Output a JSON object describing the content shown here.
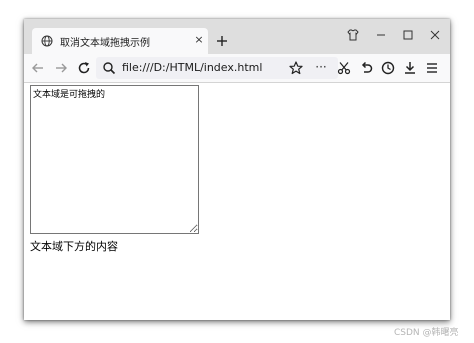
{
  "tab": {
    "title": "取消文本域拖拽示例",
    "close_glyph": "×",
    "favicon": "globe-icon"
  },
  "toolbar": {
    "url": "file:///D:/HTML/index.html",
    "more_glyph": "···",
    "icons": [
      "back-arrow-icon",
      "forward-arrow-icon",
      "reload-icon",
      "search-icon",
      "star-icon",
      "scissors-icon",
      "undo-icon",
      "history-clock-icon",
      "download-icon",
      "menu-icon"
    ]
  },
  "window_controls": [
    "shirt-icon",
    "minimize-icon",
    "maximize-icon",
    "close-icon"
  ],
  "page": {
    "textarea_value": "文本域是可拖拽的",
    "below_text": "文本域下方的内容"
  },
  "watermark": "CSDN @韩曙亮"
}
